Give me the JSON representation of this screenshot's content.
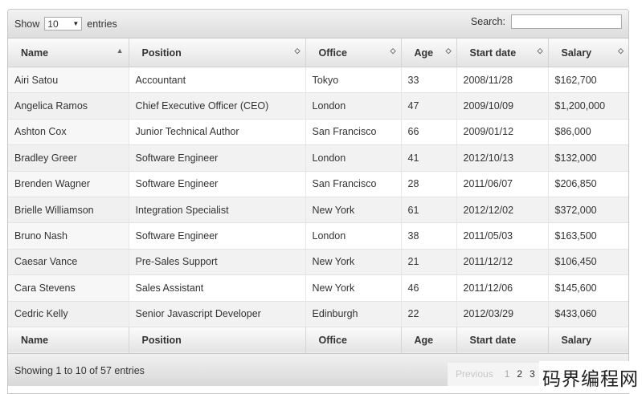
{
  "toolbar": {
    "show_label": "Show",
    "length_value": "10",
    "entries_label": "entries",
    "search_label": "Search:",
    "search_value": ""
  },
  "table": {
    "columns": [
      "Name",
      "Position",
      "Office",
      "Age",
      "Start date",
      "Salary"
    ],
    "rows": [
      [
        "Airi Satou",
        "Accountant",
        "Tokyo",
        "33",
        "2008/11/28",
        "$162,700"
      ],
      [
        "Angelica Ramos",
        "Chief Executive Officer (CEO)",
        "London",
        "47",
        "2009/10/09",
        "$1,200,000"
      ],
      [
        "Ashton Cox",
        "Junior Technical Author",
        "San Francisco",
        "66",
        "2009/01/12",
        "$86,000"
      ],
      [
        "Bradley Greer",
        "Software Engineer",
        "London",
        "41",
        "2012/10/13",
        "$132,000"
      ],
      [
        "Brenden Wagner",
        "Software Engineer",
        "San Francisco",
        "28",
        "2011/06/07",
        "$206,850"
      ],
      [
        "Brielle Williamson",
        "Integration Specialist",
        "New York",
        "61",
        "2012/12/02",
        "$372,000"
      ],
      [
        "Bruno Nash",
        "Software Engineer",
        "London",
        "38",
        "2011/05/03",
        "$163,500"
      ],
      [
        "Caesar Vance",
        "Pre-Sales Support",
        "New York",
        "21",
        "2011/12/12",
        "$106,450"
      ],
      [
        "Cara Stevens",
        "Sales Assistant",
        "New York",
        "46",
        "2011/12/06",
        "$145,600"
      ],
      [
        "Cedric Kelly",
        "Senior Javascript Developer",
        "Edinburgh",
        "22",
        "2012/03/29",
        "$433,060"
      ]
    ],
    "footer_columns": [
      "Name",
      "Position",
      "Office",
      "Age",
      "Start date",
      "Salary"
    ]
  },
  "footer": {
    "info": "Showing 1 to 10 of 57 entries",
    "previous_label": "Previous",
    "pages": [
      "1",
      "2",
      "3"
    ]
  },
  "watermark": "码界编程网",
  "icons": {
    "sort_ascending": "sort-asc-icon",
    "sort_both": "sort-both-icon",
    "select_arrow": "chevron-down-icon"
  }
}
